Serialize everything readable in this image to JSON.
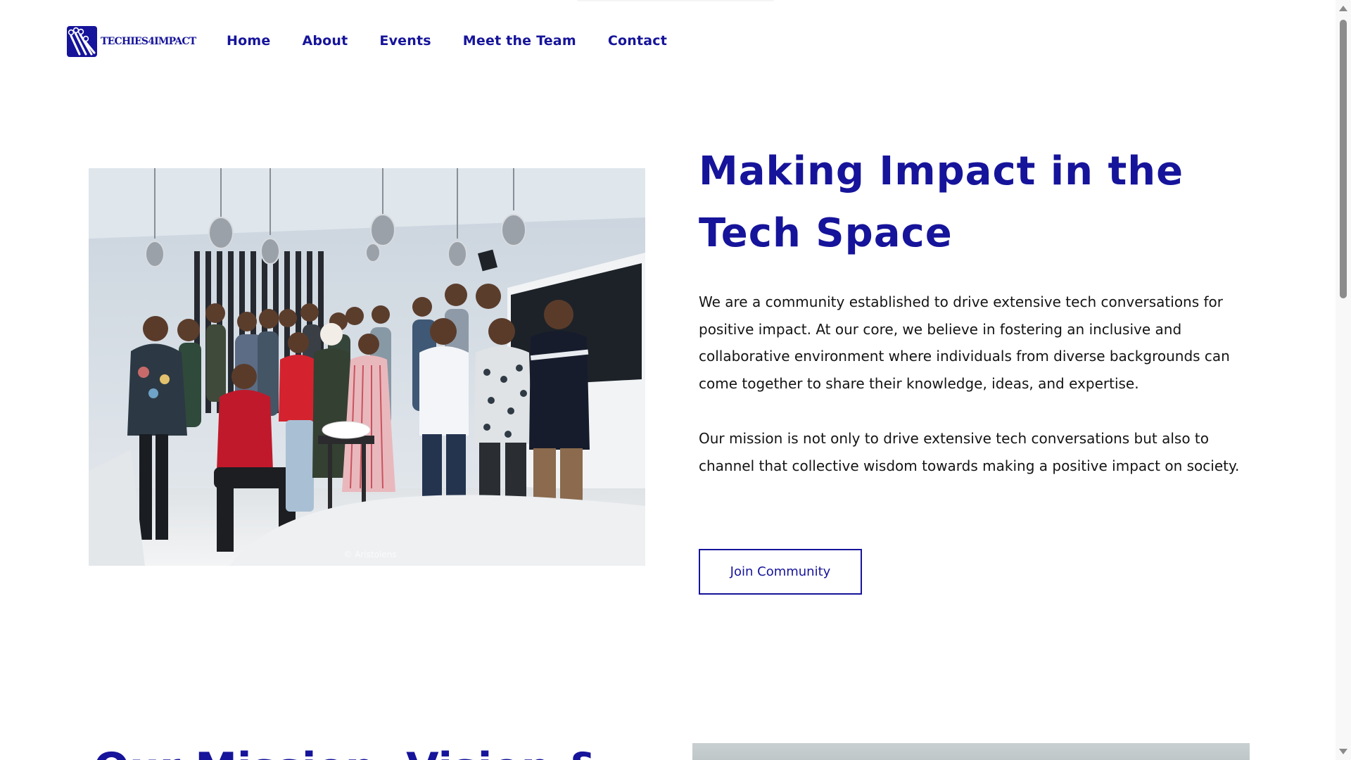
{
  "brand": {
    "name": "TECHIES4IMPACT",
    "logo_icon": "circuit-nodes-icon",
    "color": "#16149a"
  },
  "nav": {
    "items": [
      {
        "label": "Home"
      },
      {
        "label": "About"
      },
      {
        "label": "Events"
      },
      {
        "label": "Meet the Team"
      },
      {
        "label": "Contact"
      }
    ]
  },
  "hero": {
    "title_line1": "Making Impact in the",
    "title_line2": "Tech Space",
    "paragraph1": "We are a community established to drive extensive tech conversations for positive impact. At our core, we believe in fostering an inclusive and collaborative environment where individuals from diverse backgrounds can come together to share their knowledge, ideas, and expertise.",
    "paragraph2": "Our mission is not only to drive extensive tech conversations but also to channel that collective wisdom towards making a positive impact on society.",
    "photo_watermark": "© Aristolens",
    "cta_label": "Join Community"
  },
  "section2": {
    "title_partial": "Our Mission, Vision &"
  }
}
